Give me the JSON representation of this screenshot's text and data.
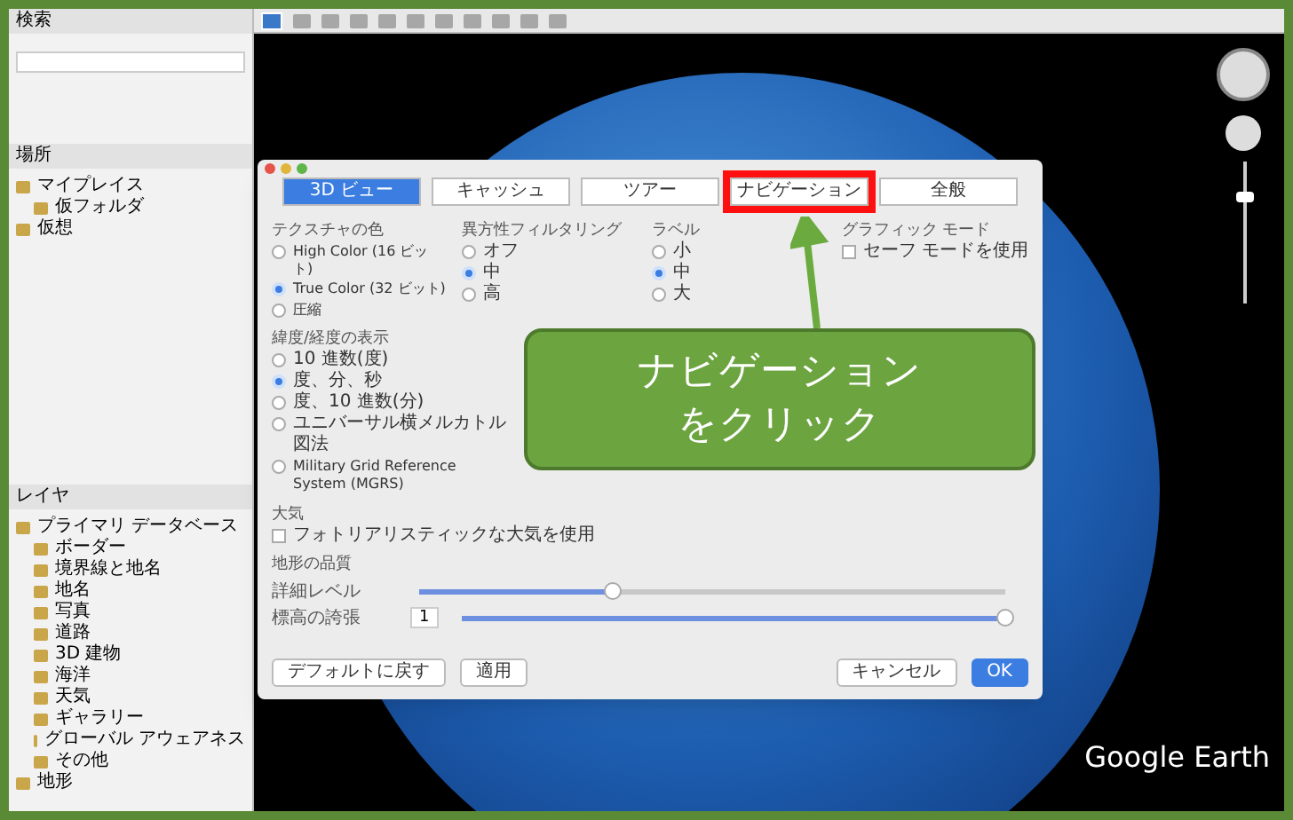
{
  "sidebar": {
    "search_title": "検索",
    "places_title": "場所",
    "places": [
      {
        "label": "マイプレイス",
        "children": [
          {
            "label": "仮フォルダ"
          }
        ]
      },
      {
        "label": "仮想"
      }
    ],
    "layers_title": "レイヤ",
    "layers": [
      {
        "label": "プライマリ データベース",
        "children": [
          {
            "label": "ボーダー"
          },
          {
            "label": "境界線と地名"
          },
          {
            "label": "地名"
          },
          {
            "label": "写真"
          },
          {
            "label": "道路"
          },
          {
            "label": "3D 建物"
          },
          {
            "label": "海洋"
          },
          {
            "label": "天気"
          },
          {
            "label": "ギャラリー"
          },
          {
            "label": "グローバル アウェアネス"
          },
          {
            "label": "その他"
          }
        ]
      },
      {
        "label": "地形"
      }
    ]
  },
  "zoom_slider": {
    "level": 0.75
  },
  "dialog": {
    "tabs": [
      {
        "label": "3D ビュー",
        "selected": true
      },
      {
        "label": "キャッシュ",
        "selected": false
      },
      {
        "label": "ツアー",
        "selected": false
      },
      {
        "label": "ナビゲーション",
        "selected": false
      },
      {
        "label": "全般",
        "selected": false
      }
    ],
    "groups": [
      {
        "title": "テクスチャの色",
        "options": [
          {
            "label": "High Color (16 ビット)",
            "selected": false
          },
          {
            "label": "True Color (32 ビット)",
            "selected": true
          },
          {
            "label": "圧縮",
            "selected": false
          }
        ]
      },
      {
        "title": "異方性フィルタリング",
        "options": [
          {
            "label": "オフ",
            "selected": false
          },
          {
            "label": "中",
            "selected": true
          },
          {
            "label": "高",
            "selected": false
          }
        ]
      },
      {
        "title": "ラベル",
        "options": [
          {
            "label": "小",
            "selected": false
          },
          {
            "label": "中",
            "selected": true
          },
          {
            "label": "大",
            "selected": false
          }
        ]
      }
    ],
    "graphics": {
      "title": "グラフィック モード",
      "checkbox": {
        "label": "セーフ モードを使用",
        "checked": false
      }
    },
    "latlon": {
      "title": "緯度/経度の表示",
      "options": [
        {
          "label": "10 進数(度)",
          "selected": false
        },
        {
          "label": "度、分、秒",
          "selected": true
        },
        {
          "label": "度、10 進数(分)",
          "selected": false
        },
        {
          "label": "ユニバーサル横メルカトル図法",
          "selected": false
        },
        {
          "label": "Military Grid Reference System (MGRS)",
          "selected": false
        }
      ]
    },
    "atmosphere": {
      "title": "大気",
      "checkbox": {
        "label": "フォトリアリスティックな大気を使用",
        "checked": false
      }
    },
    "terrain_title": "地形の品質",
    "sliders": [
      {
        "label": "詳細レベル",
        "level": 0.33
      },
      {
        "label": "標高の誇張",
        "value": "1",
        "level": 1
      }
    ],
    "buttons": [
      {
        "label": "デフォルトに戻す",
        "kind": "plain"
      },
      {
        "label": "適用",
        "kind": "plain"
      },
      {
        "label": "キャンセル",
        "kind": "plain"
      },
      {
        "label": "OK",
        "kind": "primary"
      }
    ]
  },
  "callout": {
    "lines": [
      "ナビゲーション",
      "をクリック"
    ]
  },
  "brand": "Google Earth"
}
